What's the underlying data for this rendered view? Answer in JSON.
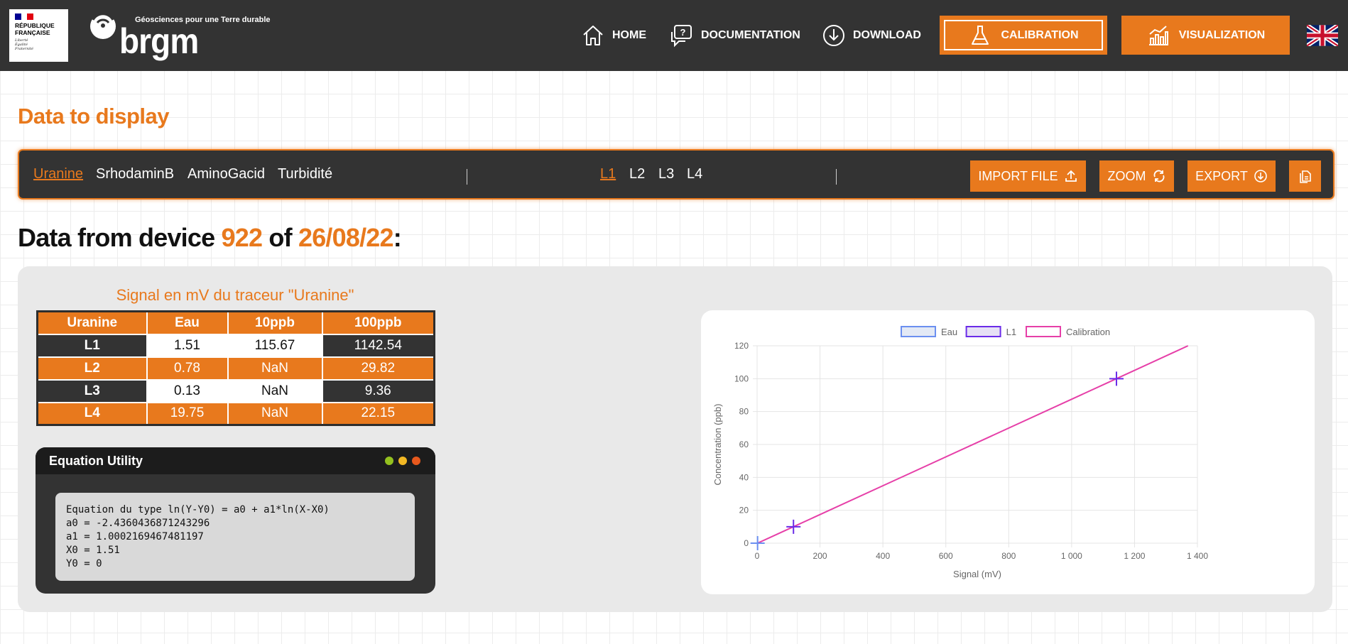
{
  "header": {
    "rf_logo": {
      "title_lines": [
        "RÉPUBLIQUE",
        "FRANÇAISE"
      ],
      "motto_lines": [
        "Liberté",
        "Égalité",
        "Fraternité"
      ]
    },
    "brgm": {
      "tagline": "Géosciences pour une Terre durable",
      "wordmark": "brgm"
    },
    "nav": {
      "home": "HOME",
      "documentation": "DOCUMENTATION",
      "download": "DOWNLOAD",
      "calibration": "CALIBRATION",
      "visualization": "VISUALIZATION"
    },
    "language_icon": "uk-flag-icon"
  },
  "data_title": "Data to display",
  "toolbar": {
    "tracers": [
      "Uranine",
      "SrhodaminB",
      "AminoGacid",
      "Turbidité"
    ],
    "active_tracer": "Uranine",
    "lunits": [
      "L1",
      "L2",
      "L3",
      "L4"
    ],
    "active_lunit": "L1",
    "import_label": "IMPORT FILE",
    "zoom_label": "ZOOM",
    "export_label": "EXPORT"
  },
  "heading": {
    "prefix": "Data from device",
    "device": "922",
    "of": "of",
    "date": "26/08/22",
    "suffix": ":"
  },
  "table": {
    "title": "Signal en mV du traceur \"Uranine\"",
    "headers": [
      "Uranine",
      "Eau",
      "10ppb",
      "100ppb"
    ],
    "rows": [
      [
        "L1",
        "1.51",
        "115.67",
        "1142.54"
      ],
      [
        "L2",
        "0.78",
        "NaN",
        "29.82"
      ],
      [
        "L3",
        "0.13",
        "NaN",
        "9.36"
      ],
      [
        "L4",
        "19.75",
        "NaN",
        "22.15"
      ]
    ]
  },
  "equation": {
    "title": "Equation Utility",
    "lines": [
      "Equation du type ln(Y-Y0) = a0 + a1*ln(X-X0)",
      "a0 = -2.4360436871243296",
      "a1 = 1.0002169467481197",
      "X0 = 1.51",
      "Y0 = 0"
    ]
  },
  "colors": {
    "accent": "#e8791d",
    "dark": "#333333",
    "eau": "#6b8ff0",
    "l1": "#6a2be8",
    "calibration": "#e63fa8"
  },
  "chart_data": {
    "type": "scatter",
    "xlabel": "Signal (mV)",
    "ylabel": "Concentration (ppb)",
    "xlim": [
      0,
      1400
    ],
    "ylim": [
      0,
      120
    ],
    "xticks": [
      0,
      200,
      400,
      600,
      800,
      1000,
      1200,
      1400
    ],
    "xtick_labels": [
      "0",
      "200",
      "400",
      "600",
      "800",
      "1 000",
      "1 200",
      "1 400"
    ],
    "yticks": [
      0,
      20,
      40,
      60,
      80,
      100,
      120
    ],
    "grid": true,
    "legend_position": "top",
    "series": [
      {
        "name": "Eau",
        "type": "scatter",
        "points": [
          [
            1.51,
            0
          ]
        ]
      },
      {
        "name": "L1",
        "type": "scatter",
        "points": [
          [
            115.67,
            10
          ],
          [
            1142.54,
            100
          ]
        ]
      },
      {
        "name": "Calibration",
        "type": "line",
        "points": [
          [
            1.51,
            0
          ],
          [
            115.67,
            10
          ],
          [
            1142.54,
            100
          ],
          [
            1370,
            120
          ]
        ]
      }
    ]
  }
}
